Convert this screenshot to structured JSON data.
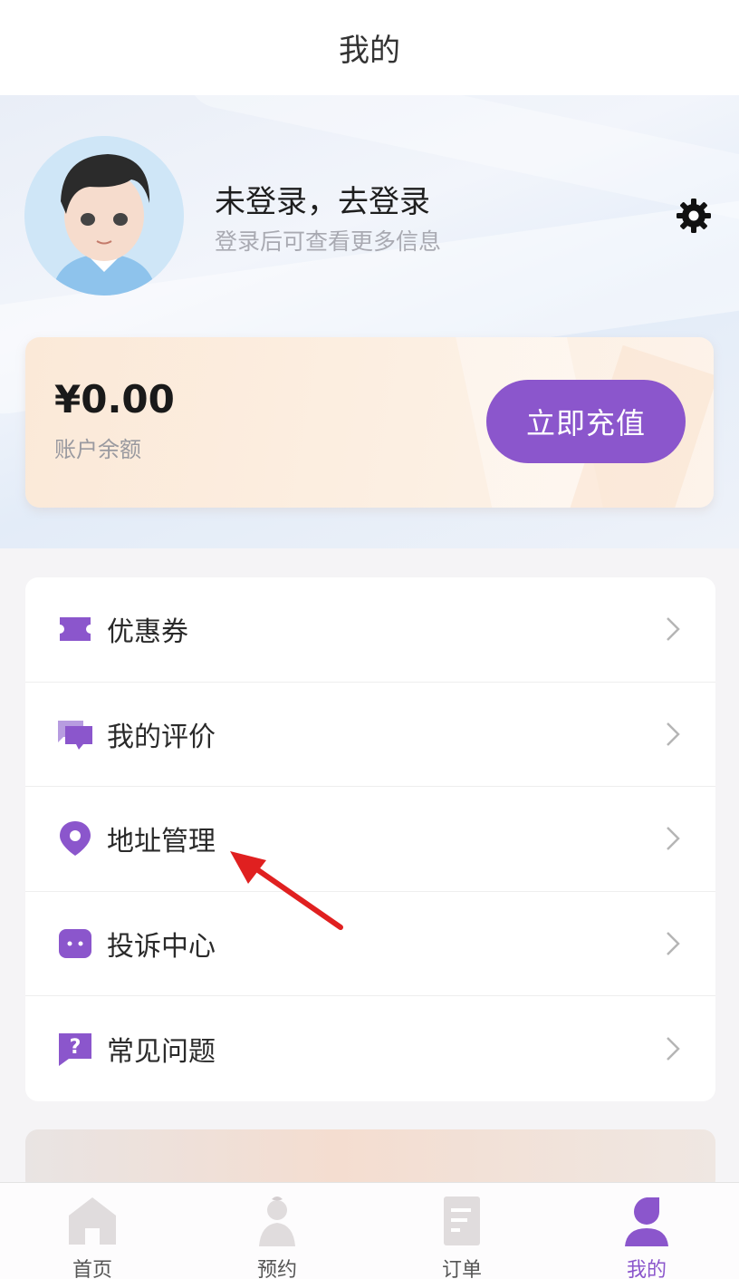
{
  "header": {
    "title": "我的"
  },
  "profile": {
    "login_title": "未登录，去登录",
    "login_subtitle": "登录后可查看更多信息"
  },
  "balance": {
    "amount": "¥0.00",
    "label": "账户余额",
    "recharge_label": "立即充值"
  },
  "menu": {
    "items": [
      {
        "label": "优惠券",
        "icon": "coupon-icon"
      },
      {
        "label": "我的评价",
        "icon": "chat-bubbles-icon"
      },
      {
        "label": "地址管理",
        "icon": "location-pin-icon"
      },
      {
        "label": "投诉中心",
        "icon": "complaint-icon"
      },
      {
        "label": "常见问题",
        "icon": "question-icon"
      }
    ]
  },
  "tabs": [
    {
      "label": "首页",
      "icon": "home-icon",
      "active": false
    },
    {
      "label": "预约",
      "icon": "reservation-icon",
      "active": false
    },
    {
      "label": "订单",
      "icon": "order-icon",
      "active": false
    },
    {
      "label": "我的",
      "icon": "profile-icon",
      "active": true
    }
  ],
  "colors": {
    "accent": "#8b56cc",
    "annotation_arrow": "#e02020"
  }
}
